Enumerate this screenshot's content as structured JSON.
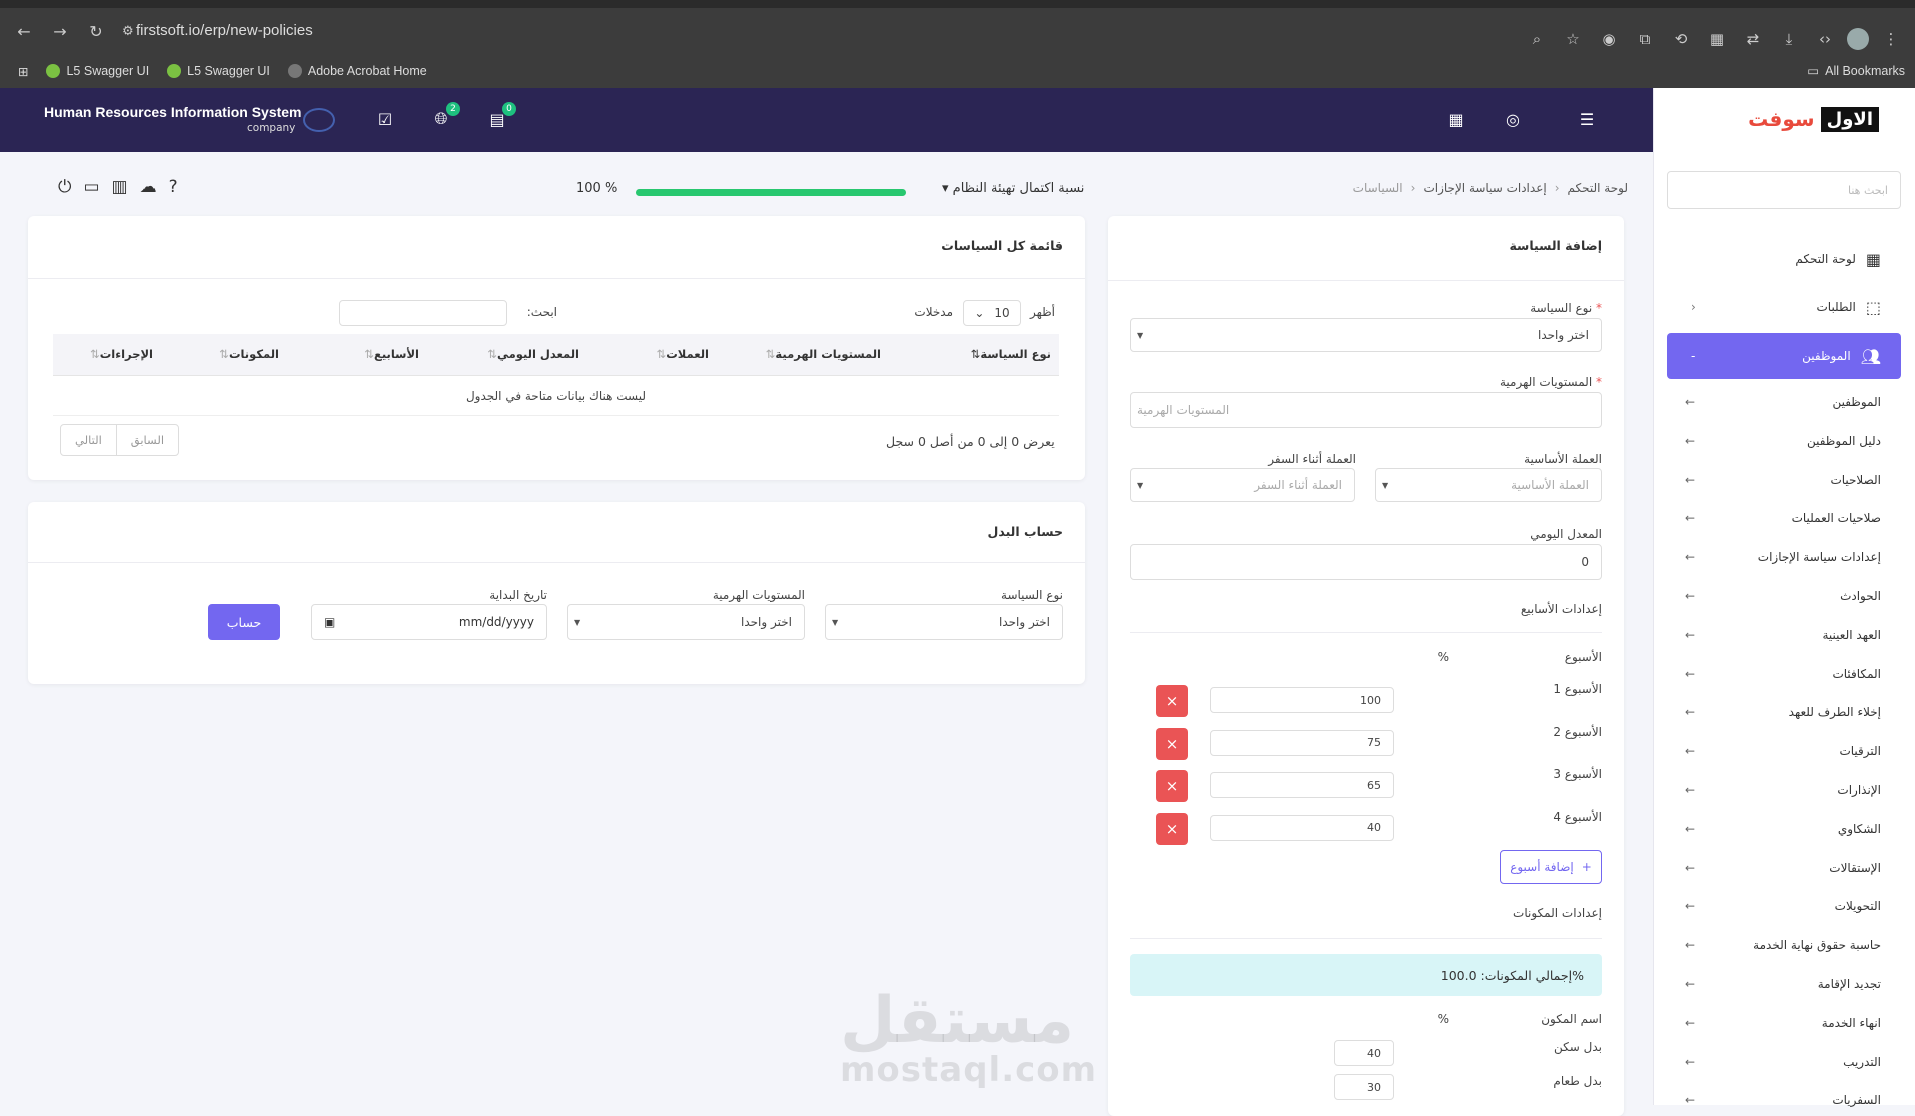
{
  "browser": {
    "url": "firstsoft.io/erp/new-policies",
    "bookmarks": [
      "L5 Swagger UI",
      "L5 Swagger UI",
      "Adobe Acrobat Home"
    ],
    "all_bookmarks": "All Bookmarks"
  },
  "topbar": {
    "title": "Human Resources Information System",
    "subtitle": "company",
    "badge_globe": "2",
    "badge_chat": "0"
  },
  "sidebar": {
    "logo_dark": "الاول",
    "logo_red": "سوفت",
    "search_placeholder": "ابحث هنا",
    "items": [
      {
        "label": "لوحة التحكم"
      },
      {
        "label": "الطلبات"
      },
      {
        "label": "الموظفين"
      }
    ],
    "sub_items": [
      "الموظفين",
      "دليل الموظفين",
      "الصلاحيات",
      "صلاحيات العمليات",
      "إعدادات سياسة الإجازات",
      "الحوادث",
      "العهد العينية",
      "المكافئات",
      "إخلاء الطرف للعهد",
      "الترقيات",
      "الإنذارات",
      "الشكاوي",
      "الإستقالات",
      "التحويلات",
      "حاسبة حقوق نهاية الخدمة",
      "تجديد الإقامة",
      "انهاء الخدمة",
      "التدريب",
      "السفريات"
    ]
  },
  "header": {
    "breadcrumb": [
      "لوحة التحكم",
      "إعدادات سياسة الإجازات",
      "السياسات"
    ],
    "completion_label": "نسبة اكتمال تهيئة النظام",
    "completion_value": "100 %",
    "completion_fraction": 1.0
  },
  "add_policy": {
    "title": "إضافة السياسة",
    "policy_type_label": "نوع السياسة",
    "policy_type_value": "اختر واحدا",
    "hier_label": "المستويات الهرمية",
    "hier_placeholder": "المستويات الهرمية",
    "base_currency_label": "العملة الأساسية",
    "base_currency_placeholder": "العملة الأساسية",
    "travel_currency_label": "العملة أثناء السفر",
    "travel_currency_placeholder": "العملة أثناء السفر",
    "daily_rate_label": "المعدل اليومي",
    "daily_rate_value": "0",
    "weeks_section": "إعدادات الأسابيع",
    "week_col": "الأسبوع",
    "pct_col": "%",
    "weeks": [
      {
        "label": "الأسبوع 1",
        "value": "100"
      },
      {
        "label": "الأسبوع 2",
        "value": "75"
      },
      {
        "label": "الأسبوع 3",
        "value": "65"
      },
      {
        "label": "الأسبوع 4",
        "value": "40"
      }
    ],
    "delete_glyph": "×",
    "add_week": "إضافة أسبوع",
    "add_glyph": "+",
    "components_section": "إعدادات المكونات",
    "components_total": "إجمالي المكونات: 100.0%",
    "component_col": "اسم المكون",
    "components": [
      {
        "label": "بدل سكن",
        "value": "40"
      },
      {
        "label": "بدل طعام",
        "value": "30"
      }
    ]
  },
  "policies_list": {
    "title": "قائمة كل السياسات",
    "show_label": "أظهر",
    "entries_label": "مدخلات",
    "page_size": "10",
    "search_label": "ابحث:",
    "columns": [
      "نوع السياسة",
      "المستويات الهرمية",
      "العملات",
      "المعدل اليومي",
      "الأسابيع",
      "المكونات",
      "الإجراءات"
    ],
    "empty_message": "ليست هناك بيانات متاحة في الجدول",
    "info": "يعرض 0 إلى 0 من أصل 0 سجل",
    "prev": "السابق",
    "next": "التالي"
  },
  "calc": {
    "title": "حساب البدل",
    "policy_type_label": "نوع السياسة",
    "policy_type_value": "اختر واحدا",
    "hier_label": "المستويات الهرمية",
    "hier_value": "اختر واحدا",
    "start_date_label": "تاريخ البداية",
    "start_date_value": "mm/dd/yyyy",
    "calc_button": "حساب"
  },
  "watermark": {
    "ar": "مستقل",
    "en": "mostaql.com"
  },
  "colors": {
    "primary": "#7367f0",
    "topbar": "#2b2554",
    "danger": "#ea5455",
    "success": "#28c76f",
    "info_bg": "#d8f5f7"
  }
}
